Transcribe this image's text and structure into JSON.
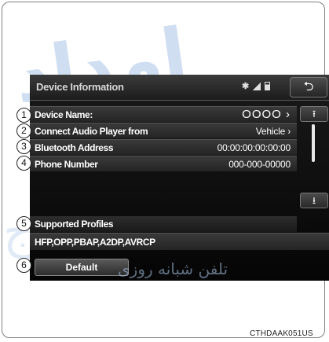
{
  "screen": {
    "title": "Device Information",
    "status_icons": [
      "bluetooth-icon",
      "signal-icon",
      "battery-icon"
    ],
    "back_icon": "back-arrow-icon"
  },
  "rows": [
    {
      "label": "Device Name:",
      "value": "OOOO ›"
    },
    {
      "label": "Connect Audio Player from",
      "value": "Vehicle ›"
    },
    {
      "label": "Bluetooth Address",
      "value": "00:00:00:00:00:00"
    },
    {
      "label": "Phone Number",
      "value": "000-000-00000"
    }
  ],
  "supported_profiles": {
    "label": "Supported Profiles",
    "value": "HFP,OPP,PBAP,A2DP,AVRCP"
  },
  "default_button": "Default",
  "scroll": {
    "up": "⇞",
    "down": "⇟"
  },
  "callouts": [
    "1",
    "2",
    "3",
    "4",
    "5",
    "6"
  ],
  "watermark": {
    "arabic_large": "امداد",
    "arabic_small": "تلفن شبانه روزی"
  },
  "image_code": "CTHDAAK051US",
  "colors": {
    "screen_bg": "#0a0a0a",
    "row_bg": "#2f2f2f",
    "text": "#ffffff",
    "watermark": "#a9c4e6"
  }
}
